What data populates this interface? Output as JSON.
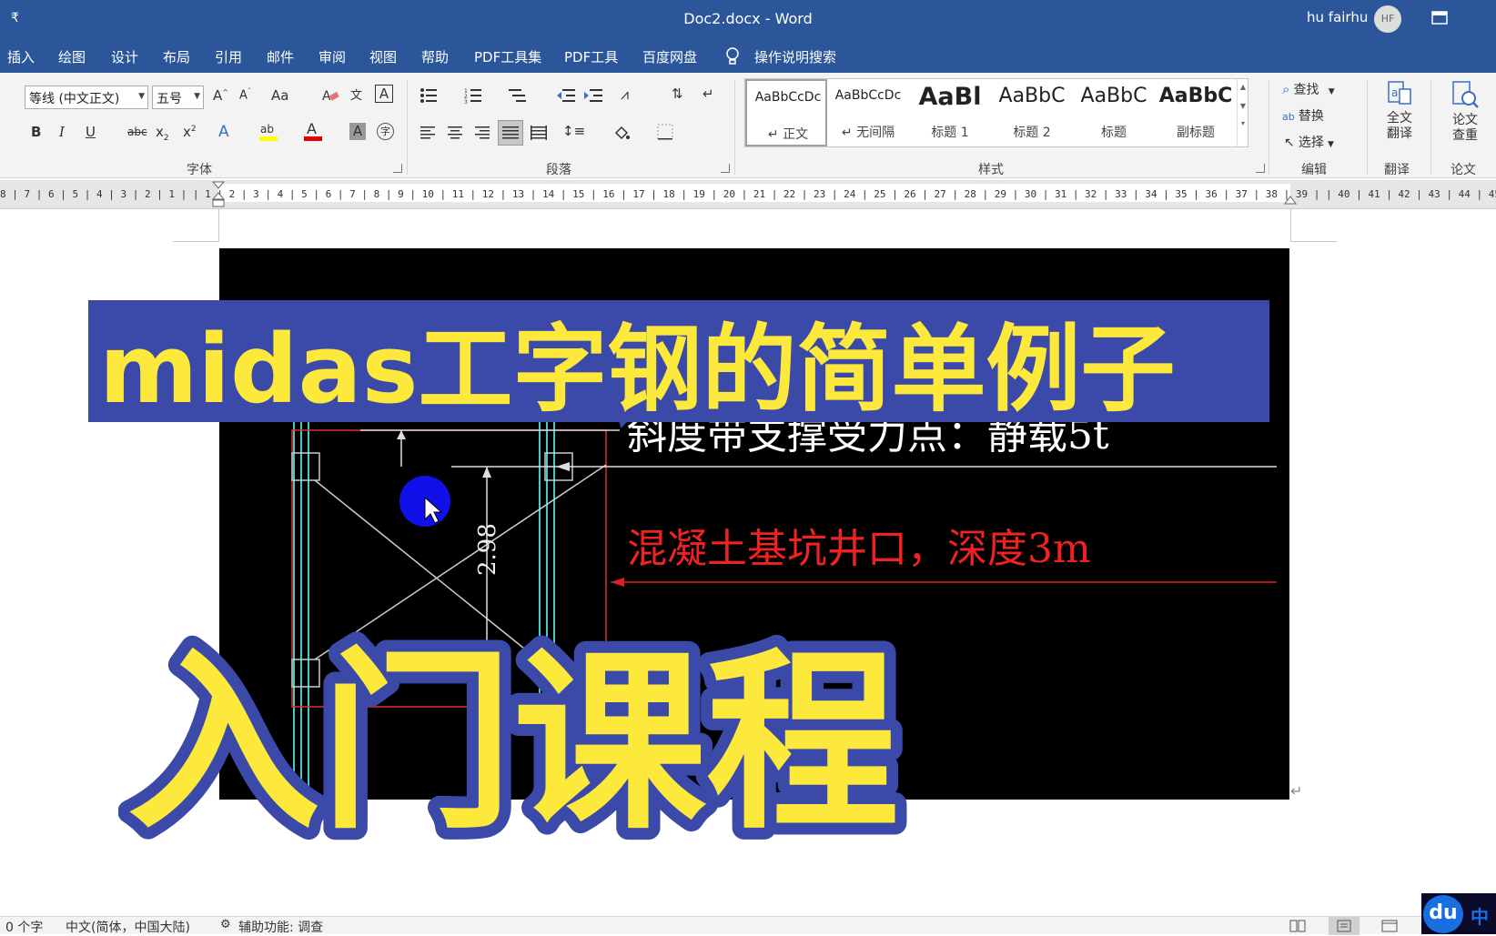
{
  "window": {
    "quick_access": "₹",
    "title": "Doc2.docx  -  Word",
    "user_name": "hu fairhu",
    "user_initials": "HF"
  },
  "tabs": [
    "插入",
    "绘图",
    "设计",
    "布局",
    "引用",
    "邮件",
    "审阅",
    "视图",
    "帮助",
    "PDF工具集",
    "PDF工具",
    "百度网盘"
  ],
  "tell_me": "操作说明搜索",
  "ribbon": {
    "font_name": "等线 (中文正文)",
    "font_size": "五号",
    "group_font": "字体",
    "group_paragraph": "段落",
    "group_styles": "样式",
    "group_edit": "编辑",
    "group_translate": "翻译",
    "group_paper": "论文",
    "styles": [
      {
        "preview": "AaBbCcDc",
        "name": "↵ 正文"
      },
      {
        "preview": "AaBbCcDc",
        "name": "↵ 无间隔"
      },
      {
        "preview": "AaBl",
        "name": "标题 1"
      },
      {
        "preview": "AaBbC",
        "name": "标题 2"
      },
      {
        "preview": "AaBbC",
        "name": "标题"
      },
      {
        "preview": "AaBbC",
        "name": "副标题"
      }
    ],
    "find": "查找",
    "replace": "替换",
    "select": "选择",
    "full_translate": "全文\n翻译",
    "paper_check": "论文\n查重"
  },
  "ruler_text": "8 | 7 | 6 | 5 | 4 | 3 | 2 | 1 |   | 1 | 2 | 3 | 4 | 5 | 6 | 7 | 8 | 9 | 10 | 11 | 12 | 13 | 14 | 15 | 16 | 17 | 18 | 19 | 20 | 21 | 22 | 23 | 24 | 25 | 26 | 27 | 28 | 29 | 30 | 31 | 32 | 33 | 34 | 35 | 36 | 37 | 38 | 39 |   | 40 | 41 | 42 | 43 | 44 | 45 | 46 | 47",
  "cad": {
    "label_load": "斜度带支撑受力点：静载5t",
    "label_pit": "混凝土基坑井口，深度3m",
    "dimension": "2.98"
  },
  "overlay": {
    "title_line1": "midas工字钢的简单例子",
    "title_line2": "入门课程"
  },
  "status": {
    "word_count": "0 个字",
    "language": "中文(简体，中国大陆)",
    "accessibility": "辅助功能: 调查",
    "ime": "中"
  }
}
